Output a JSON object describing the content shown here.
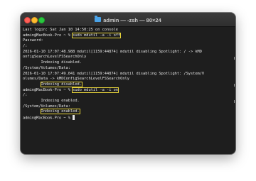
{
  "window": {
    "title": "admin — -zsh — 80×24"
  },
  "terminal": {
    "lines": [
      {
        "pre": "Last login: Sat Jan 10 14:50:25 on console",
        "hl": "",
        "post": ""
      },
      {
        "pre": "admin@MacBook-Pro ~ % ",
        "hl": "sudo mdutil -a -i off",
        "post": ""
      },
      {
        "pre": "Password:",
        "hl": "",
        "post": ""
      },
      {
        "pre": "/:",
        "hl": "",
        "post": ""
      },
      {
        "pre": "2026-01-10 17:07:48.988 mdutil[1159:44874] mdutil disabling Spotlight: / -> kMD",
        "hl": "",
        "post": ""
      },
      {
        "pre": "onfigSearchLevelFSSearchOnly",
        "hl": "",
        "post": ""
      },
      {
        "pre": "        Indexing disabled.",
        "hl": "",
        "post": ""
      },
      {
        "pre": "/System/Volumes/Data:",
        "hl": "",
        "post": ""
      },
      {
        "pre": "2026-01-10 17:07:49.041 mdutil[1159:44874] mdutil disabling Spotlight: /System/V",
        "hl": "",
        "post": ""
      },
      {
        "pre": "olumes/Data -> kMDConfigSearchLevelFSSearchOnly",
        "hl": "",
        "post": ""
      },
      {
        "pre": "        ",
        "hl": "Indexing disabled.",
        "post": ""
      },
      {
        "pre": "admin@MacBook-Pro ~ % ",
        "hl": "sudo mdutil -a -i on",
        "post": ""
      },
      {
        "pre": "/:",
        "hl": "",
        "post": ""
      },
      {
        "pre": "        Indexing enabled.",
        "hl": "",
        "post": ""
      },
      {
        "pre": "/System/Volumes/Data:",
        "hl": "",
        "post": ""
      },
      {
        "pre": "        ",
        "hl": "Indexing enabled.",
        "post": ""
      },
      {
        "pre": "admin@MacBook-Pro ~ % ",
        "hl": "",
        "post": ""
      }
    ]
  },
  "colors": {
    "background": "#1e1e1e",
    "text": "#e6e6e6",
    "highlight": "#e6d33a"
  }
}
